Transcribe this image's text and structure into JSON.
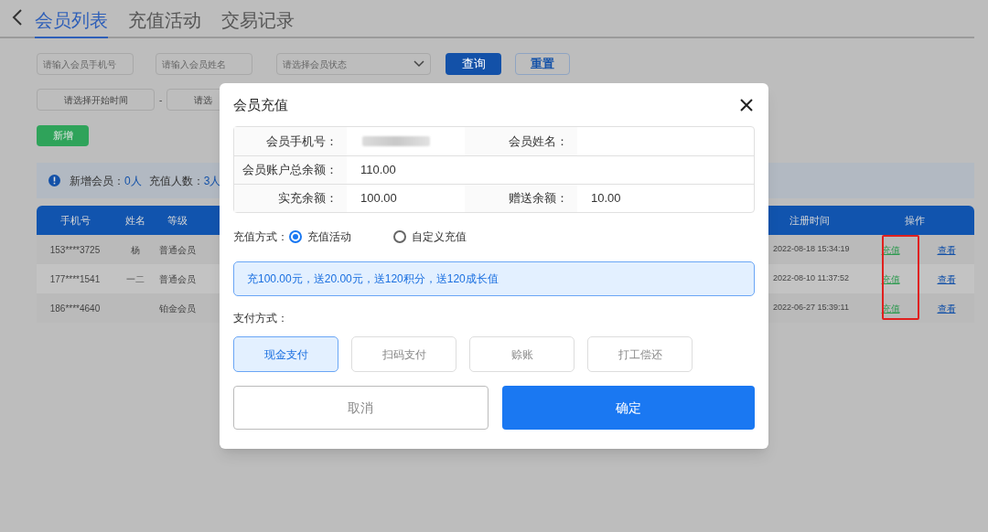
{
  "tabs": [
    {
      "label": "会员列表",
      "selected": true
    },
    {
      "label": "充值活动",
      "selected": false
    },
    {
      "label": "交易记录",
      "selected": false
    }
  ],
  "filters": {
    "phone": {
      "placeholder": "请输入会员手机号"
    },
    "name": {
      "placeholder": "请输入会员姓名"
    },
    "status": {
      "placeholder": "请选择会员状态"
    },
    "query": "查询",
    "reset": "重置",
    "start_time": {
      "placeholder": "请选择开始时间"
    },
    "separator": "-",
    "end_time": {
      "placeholder": "请选"
    }
  },
  "add_button": "新增",
  "stats": [
    {
      "label": "新增会员：",
      "value": "0人"
    },
    {
      "label": "充值人数：",
      "value": "3人"
    }
  ],
  "table": {
    "columns": [
      "手机号",
      "姓名",
      "等级",
      "注册时间",
      "操作"
    ],
    "rows": [
      {
        "phone": "153****3725",
        "name": "杨",
        "level": "普通会员",
        "registered": "2022-08-18 15:34:19",
        "actions": [
          "充值",
          "查看"
        ]
      },
      {
        "phone": "177****1541",
        "name": "一二",
        "level": "普通会员",
        "registered": "2022-08-10 11:37:52",
        "actions": [
          "充值",
          "查看"
        ]
      },
      {
        "phone": "186****4640",
        "level": "铂金会员",
        "registered": "2022-06-27 15:39:11",
        "actions": [
          "充值",
          "查看"
        ]
      }
    ]
  },
  "dialog": {
    "title": "会员充值",
    "info_rows": [
      [
        {
          "label": "会员手机号：",
          "blurred": true
        },
        {
          "label": "会员姓名："
        }
      ],
      [
        {
          "label": "会员账户总余额：",
          "value": "110.00"
        }
      ],
      [
        {
          "label": "实充余额：",
          "value": "100.00"
        },
        {
          "label": "赠送余额：",
          "value": "10.00"
        }
      ]
    ],
    "recharge_method": {
      "label": "充值方式：",
      "options": [
        {
          "label": "充值活动",
          "selected": true
        },
        {
          "label": "自定义充值",
          "selected": false
        }
      ]
    },
    "activity": "充100.00元，送20.00元，送120积分，送120成长值",
    "payment": {
      "label": "支付方式：",
      "options": [
        {
          "label": "现金支付",
          "selected": true
        },
        {
          "label": "扫码支付",
          "selected": false
        },
        {
          "label": "赊账",
          "selected": false
        },
        {
          "label": "打工偿还",
          "selected": false
        }
      ]
    },
    "cancel": "取消",
    "confirm": "确定"
  }
}
